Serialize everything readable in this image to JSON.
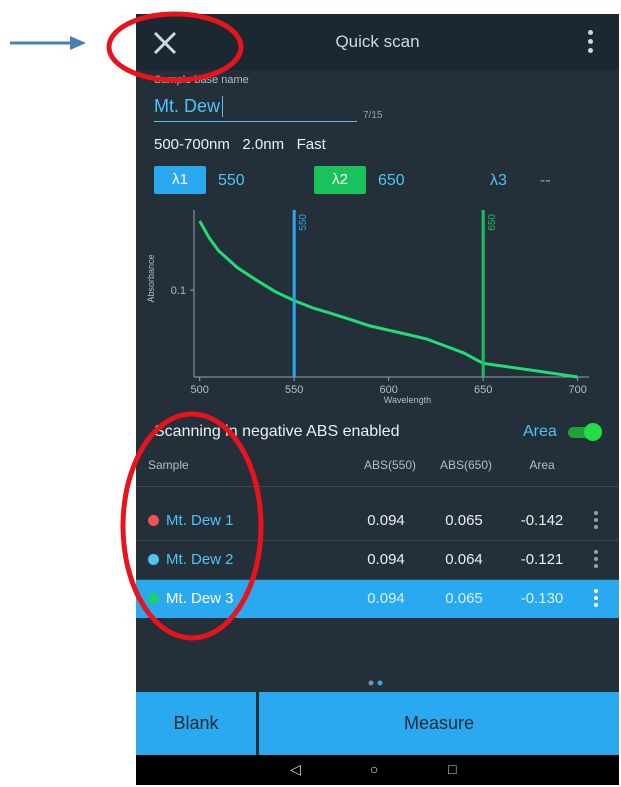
{
  "header": {
    "title": "Quick scan",
    "close_icon": "close-icon",
    "menu_icon": "overflow-menu-icon"
  },
  "form": {
    "base_name_label": "Sample base name",
    "base_name_value": "Mt. Dew",
    "char_counter": "7/15",
    "scan_params": "500-700nm   2.0nm   Fast"
  },
  "lambdas": [
    {
      "label": "λ1",
      "value": "550",
      "color": "#2aa8f0"
    },
    {
      "label": "λ2",
      "value": "650",
      "color": "#19c25a"
    },
    {
      "label": "λ3",
      "value": "--",
      "color": "#2aa8f0"
    }
  ],
  "chart_data": {
    "type": "line",
    "xlabel": "Wavelength",
    "ylabel": "Absorbance",
    "xlim": [
      497,
      706
    ],
    "yscale": "log",
    "ylim": [
      0.06,
      0.16
    ],
    "x_ticks": [
      500,
      550,
      600,
      650,
      700
    ],
    "y_ticks": [
      0.1
    ],
    "markers": [
      {
        "x": 550,
        "label": "550",
        "color": "#2aa8f0"
      },
      {
        "x": 650,
        "label": "650",
        "color": "#19c25a"
      }
    ],
    "series": [
      {
        "color": "#22dd77",
        "x": [
          500,
          505,
          510,
          520,
          530,
          540,
          550,
          560,
          570,
          580,
          590,
          600,
          610,
          620,
          630,
          640,
          650,
          660,
          670,
          680,
          690,
          700
        ],
        "y": [
          0.15,
          0.136,
          0.126,
          0.114,
          0.106,
          0.099,
          0.094,
          0.09,
          0.087,
          0.084,
          0.081,
          0.079,
          0.077,
          0.075,
          0.072,
          0.069,
          0.065,
          0.064,
          0.063,
          0.062,
          0.061,
          0.06
        ]
      }
    ]
  },
  "options": {
    "negative_abs_text": "Scanning in negative ABS enabled",
    "area_label": "Area",
    "area_enabled": true
  },
  "table": {
    "headers": [
      "Sample",
      "ABS(550)",
      "ABS(650)",
      "Area"
    ],
    "rows": [
      {
        "name": "Mt. Dew 1",
        "dot_color": "#ef5350",
        "abs550": "0.094",
        "abs650": "0.065",
        "area": "-0.142",
        "selected": false
      },
      {
        "name": "Mt. Dew 2",
        "dot_color": "#4fc3f7",
        "abs550": "0.094",
        "abs650": "0.064",
        "area": "-0.121",
        "selected": false
      },
      {
        "name": "Mt. Dew 3",
        "dot_color": "#19d26a",
        "abs550": "0.094",
        "abs650": "0.065",
        "area": "-0.130",
        "selected": true
      }
    ]
  },
  "pager": {
    "pages": 2,
    "current": 2
  },
  "buttons": {
    "blank": "Blank",
    "measure": "Measure"
  },
  "navbar": {
    "back": "◁",
    "home": "○",
    "recents": "□"
  },
  "annotation_colors": {
    "circle": "#e8131b",
    "arrow": "#4a7fb5"
  }
}
